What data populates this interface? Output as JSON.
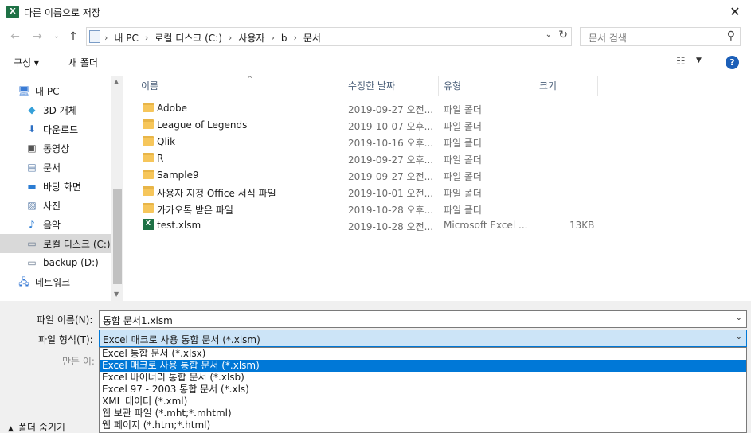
{
  "window": {
    "title": "다른 이름으로 저장",
    "app_icon_glyph": "X",
    "close_glyph": "✕"
  },
  "nav": {
    "back_glyph": "←",
    "forward_glyph": "→",
    "recent_glyph": "⌄",
    "up_glyph": "↑",
    "crumbs": [
      "내 PC",
      "로컬 디스크 (C:)",
      "사용자",
      "b",
      "문서"
    ],
    "crumb_sep": "›",
    "dropdown_glyph": "⌄",
    "refresh_glyph": "↻",
    "search_placeholder": "문서 검색",
    "search_glyph": "⚲"
  },
  "toolbar": {
    "organize": "구성 ▾",
    "new_folder": "새 폴더",
    "view_glyph": "☷",
    "view_dd_glyph": "▼",
    "help_glyph": "?"
  },
  "tree": [
    {
      "label": "내 PC",
      "icon": "pc-icon",
      "glyph": "🖥",
      "color": "#3a7bd5",
      "indent": 1
    },
    {
      "label": "3D 개체",
      "icon": "cube-icon",
      "glyph": "◆",
      "color": "#35a0d9",
      "indent": 2
    },
    {
      "label": "다운로드",
      "icon": "download-icon",
      "glyph": "⬇",
      "color": "#2d6fc3",
      "indent": 2
    },
    {
      "label": "동영상",
      "icon": "video-icon",
      "glyph": "▣",
      "color": "#555555",
      "indent": 2
    },
    {
      "label": "문서",
      "icon": "document-icon",
      "glyph": "▤",
      "color": "#5b7da8",
      "indent": 2
    },
    {
      "label": "바탕 화면",
      "icon": "desktop-icon",
      "glyph": "▬",
      "color": "#2b7cd3",
      "indent": 2
    },
    {
      "label": "사진",
      "icon": "picture-icon",
      "glyph": "▨",
      "color": "#5b7da8",
      "indent": 2
    },
    {
      "label": "음악",
      "icon": "music-icon",
      "glyph": "♪",
      "color": "#2b7cd3",
      "indent": 2
    },
    {
      "label": "로컬 디스크 (C:)",
      "icon": "drive-c-icon",
      "glyph": "▭",
      "color": "#6d7d92",
      "indent": 2,
      "selected": true
    },
    {
      "label": "backup (D:)",
      "icon": "drive-d-icon",
      "glyph": "▭",
      "color": "#6d7d92",
      "indent": 2
    },
    {
      "label": "네트워크",
      "icon": "network-icon",
      "glyph": "🖧",
      "color": "#3a7bd5",
      "indent": 1
    }
  ],
  "columns": {
    "name": "이름",
    "date": "수정한 날짜",
    "type": "유형",
    "size": "크기",
    "sort_glyph": "^"
  },
  "files": [
    {
      "name": "Adobe",
      "date": "2019-09-27 오전...",
      "type": "파일 폴더",
      "size": "",
      "kind": "folder"
    },
    {
      "name": "League of Legends",
      "date": "2019-10-07 오후...",
      "type": "파일 폴더",
      "size": "",
      "kind": "folder"
    },
    {
      "name": "Qlik",
      "date": "2019-10-16 오후...",
      "type": "파일 폴더",
      "size": "",
      "kind": "folder"
    },
    {
      "name": "R",
      "date": "2019-09-27 오후...",
      "type": "파일 폴더",
      "size": "",
      "kind": "folder"
    },
    {
      "name": "Sample9",
      "date": "2019-09-27 오전...",
      "type": "파일 폴더",
      "size": "",
      "kind": "folder"
    },
    {
      "name": "사용자 지정 Office 서식 파일",
      "date": "2019-10-01 오전...",
      "type": "파일 폴더",
      "size": "",
      "kind": "folder"
    },
    {
      "name": "카카오톡 받은 파일",
      "date": "2019-10-28 오후...",
      "type": "파일 폴더",
      "size": "",
      "kind": "folder"
    },
    {
      "name": "test.xlsm",
      "date": "2019-10-28 오전...",
      "type": "Microsoft Excel ...",
      "size": "13KB",
      "kind": "excel"
    }
  ],
  "form": {
    "filename_label": "파일 이름(N):",
    "filename_value": "통합 문서1.xlsm",
    "filetype_label": "파일 형식(T):",
    "filetype_value": "Excel 매크로 사용 통합 문서 (*.xlsm)",
    "authors_label": "만든 이:",
    "dd_glyph": "⌄",
    "hide_folders": "폴더 숨기기",
    "hide_chevron": "▲"
  },
  "filetype_options": [
    {
      "label": "Excel 통합 문서 (*.xlsx)",
      "selected": false
    },
    {
      "label": "Excel 매크로 사용 통합 문서 (*.xlsm)",
      "selected": true
    },
    {
      "label": "Excel 바이너리 통합 문서 (*.xlsb)",
      "selected": false
    },
    {
      "label": "Excel 97 - 2003 통합 문서 (*.xls)",
      "selected": false
    },
    {
      "label": "XML 데이터 (*.xml)",
      "selected": false
    },
    {
      "label": "웹 보관 파일 (*.mht;*.mhtml)",
      "selected": false
    },
    {
      "label": "웹 페이지 (*.htm;*.html)",
      "selected": false
    }
  ],
  "colors": {
    "accent": "#0078d7",
    "excel_green": "#1e7145",
    "folder_yellow": "#f6c65b"
  }
}
